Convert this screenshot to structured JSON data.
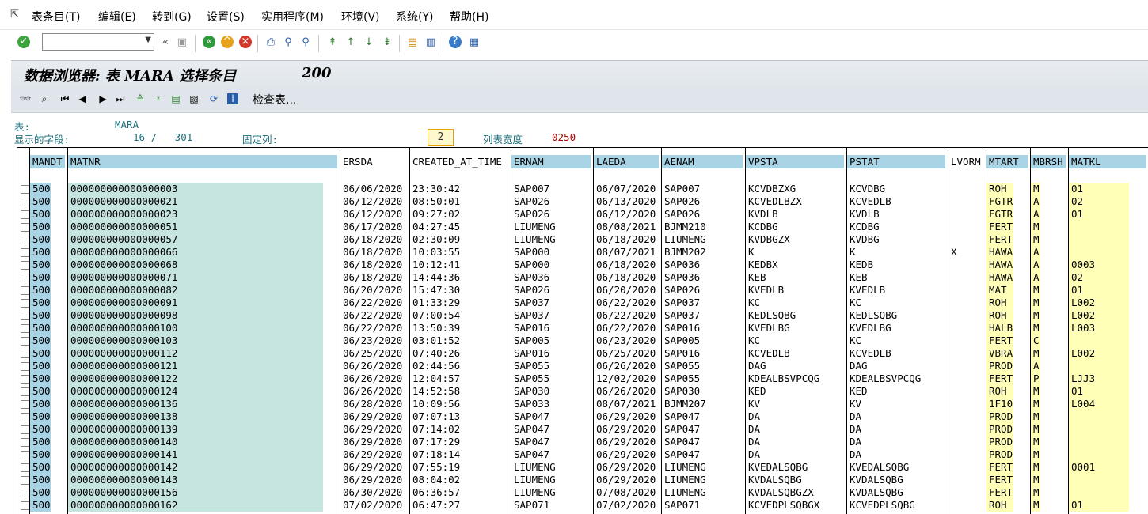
{
  "menu": {
    "items": [
      "表条目(T)",
      "编辑(E)",
      "转到(G)",
      "设置(S)",
      "实用程序(M)",
      "环境(V)",
      "系统(Y)",
      "帮助(H)"
    ]
  },
  "okcode": {
    "value": ""
  },
  "title": {
    "text": "数据浏览器: 表 MARA 选择条目",
    "count": "200"
  },
  "app_toolbar": {
    "check_table_label": "检查表..."
  },
  "info": {
    "table_label": "表:",
    "table_value": "MARA",
    "fields_label": "显示的字段:",
    "fields_value": "16 /   301",
    "fixed_label": "固定列:",
    "fixed_value": "2",
    "width_label": "列表宽度",
    "width_value": "0250"
  },
  "colors": {
    "accent_blue": "#a8d4e6",
    "key_teal": "#c6e4e0",
    "yellow": "#ffffb8",
    "title_bg": "#e3e8ed"
  },
  "table": {
    "columns": [
      "MANDT",
      "MATNR",
      "ERSDA",
      "CREATED_AT_TIME",
      "ERNAM",
      "LAEDA",
      "AENAM",
      "VPSTA",
      "PSTAT",
      "LVORM",
      "MTART",
      "MBRSH",
      "MATKL"
    ],
    "rows": [
      [
        "500",
        "000000000000000003",
        "06/06/2020",
        "23:30:42",
        "SAP007",
        "06/07/2020",
        "SAP007",
        "KCVDBZXG",
        "KCVDBG",
        "",
        "ROH",
        "M",
        "01"
      ],
      [
        "500",
        "000000000000000021",
        "06/12/2020",
        "08:50:01",
        "SAP026",
        "06/13/2020",
        "SAP026",
        "KCVEDLBZX",
        "KCVEDLB",
        "",
        "FGTR",
        "A",
        "02"
      ],
      [
        "500",
        "000000000000000023",
        "06/12/2020",
        "09:27:02",
        "SAP026",
        "06/12/2020",
        "SAP026",
        "KVDLB",
        "KVDLB",
        "",
        "FGTR",
        "A",
        "01"
      ],
      [
        "500",
        "000000000000000051",
        "06/17/2020",
        "04:27:45",
        "LIUMENG",
        "08/08/2021",
        "BJMM210",
        "KCDBG",
        "KCDBG",
        "",
        "FERT",
        "M",
        ""
      ],
      [
        "500",
        "000000000000000057",
        "06/18/2020",
        "02:30:09",
        "LIUMENG",
        "06/18/2020",
        "LIUMENG",
        "KVDBGZX",
        "KVDBG",
        "",
        "FERT",
        "M",
        ""
      ],
      [
        "500",
        "000000000000000066",
        "06/18/2020",
        "10:03:55",
        "SAP000",
        "08/07/2021",
        "BJMM202",
        "K",
        "K",
        "X",
        "HAWA",
        "A",
        ""
      ],
      [
        "500",
        "000000000000000068",
        "06/18/2020",
        "10:12:41",
        "SAP000",
        "06/18/2020",
        "SAP036",
        "KEDBX",
        "KEDB",
        "",
        "HAWA",
        "A",
        "0003"
      ],
      [
        "500",
        "000000000000000071",
        "06/18/2020",
        "14:44:36",
        "SAP036",
        "06/18/2020",
        "SAP036",
        "KEB",
        "KEB",
        "",
        "HAWA",
        "A",
        "02"
      ],
      [
        "500",
        "000000000000000082",
        "06/20/2020",
        "15:47:30",
        "SAP026",
        "06/20/2020",
        "SAP026",
        "KVEDLB",
        "KVEDLB",
        "",
        "MAT",
        "M",
        "01"
      ],
      [
        "500",
        "000000000000000091",
        "06/22/2020",
        "01:33:29",
        "SAP037",
        "06/22/2020",
        "SAP037",
        "KC",
        "KC",
        "",
        "ROH",
        "M",
        "L002"
      ],
      [
        "500",
        "000000000000000098",
        "06/22/2020",
        "07:00:54",
        "SAP037",
        "06/22/2020",
        "SAP037",
        "KEDLSQBG",
        "KEDLSQBG",
        "",
        "ROH",
        "M",
        "L002"
      ],
      [
        "500",
        "000000000000000100",
        "06/22/2020",
        "13:50:39",
        "SAP016",
        "06/22/2020",
        "SAP016",
        "KVEDLBG",
        "KVEDLBG",
        "",
        "HALB",
        "M",
        "L003"
      ],
      [
        "500",
        "000000000000000103",
        "06/23/2020",
        "03:01:52",
        "SAP005",
        "06/23/2020",
        "SAP005",
        "KC",
        "KC",
        "",
        "FERT",
        "C",
        ""
      ],
      [
        "500",
        "000000000000000112",
        "06/25/2020",
        "07:40:26",
        "SAP016",
        "06/25/2020",
        "SAP016",
        "KCVEDLB",
        "KCVEDLB",
        "",
        "VBRA",
        "M",
        "L002"
      ],
      [
        "500",
        "000000000000000121",
        "06/26/2020",
        "02:44:56",
        "SAP055",
        "06/26/2020",
        "SAP055",
        "DAG",
        "DAG",
        "",
        "PROD",
        "A",
        ""
      ],
      [
        "500",
        "000000000000000122",
        "06/26/2020",
        "12:04:57",
        "SAP055",
        "12/02/2020",
        "SAP055",
        "KDEALBSVPCQG",
        "KDEALBSVPCQG",
        "",
        "FERT",
        "P",
        "LJJ3"
      ],
      [
        "500",
        "000000000000000124",
        "06/26/2020",
        "14:52:58",
        "SAP030",
        "06/26/2020",
        "SAP030",
        "KED",
        "KED",
        "",
        "ROH",
        "M",
        "01"
      ],
      [
        "500",
        "000000000000000136",
        "06/28/2020",
        "10:09:56",
        "SAP033",
        "08/07/2021",
        "BJMM207",
        "KV",
        "KV",
        "",
        "1F10",
        "M",
        "L004"
      ],
      [
        "500",
        "000000000000000138",
        "06/29/2020",
        "07:07:13",
        "SAP047",
        "06/29/2020",
        "SAP047",
        "DA",
        "DA",
        "",
        "PROD",
        "M",
        ""
      ],
      [
        "500",
        "000000000000000139",
        "06/29/2020",
        "07:14:02",
        "SAP047",
        "06/29/2020",
        "SAP047",
        "DA",
        "DA",
        "",
        "PROD",
        "M",
        ""
      ],
      [
        "500",
        "000000000000000140",
        "06/29/2020",
        "07:17:29",
        "SAP047",
        "06/29/2020",
        "SAP047",
        "DA",
        "DA",
        "",
        "PROD",
        "M",
        ""
      ],
      [
        "500",
        "000000000000000141",
        "06/29/2020",
        "07:18:14",
        "SAP047",
        "06/29/2020",
        "SAP047",
        "DA",
        "DA",
        "",
        "PROD",
        "M",
        ""
      ],
      [
        "500",
        "000000000000000142",
        "06/29/2020",
        "07:55:19",
        "LIUMENG",
        "06/29/2020",
        "LIUMENG",
        "KVEDALSQBG",
        "KVEDALSQBG",
        "",
        "FERT",
        "M",
        "0001"
      ],
      [
        "500",
        "000000000000000143",
        "06/29/2020",
        "08:04:02",
        "LIUMENG",
        "06/29/2020",
        "LIUMENG",
        "KVDALSQBG",
        "KVDALSQBG",
        "",
        "FERT",
        "M",
        ""
      ],
      [
        "500",
        "000000000000000156",
        "06/30/2020",
        "06:36:57",
        "LIUMENG",
        "07/08/2020",
        "LIUMENG",
        "KVDALSQBGZX",
        "KVDALSQBG",
        "",
        "FERT",
        "M",
        ""
      ],
      [
        "500",
        "000000000000000162",
        "07/02/2020",
        "06:47:27",
        "SAP071",
        "07/02/2020",
        "SAP071",
        "KCVEDPLSQBGX",
        "KCVEDPLSQBG",
        "",
        "ROH",
        "M",
        "01"
      ]
    ]
  }
}
